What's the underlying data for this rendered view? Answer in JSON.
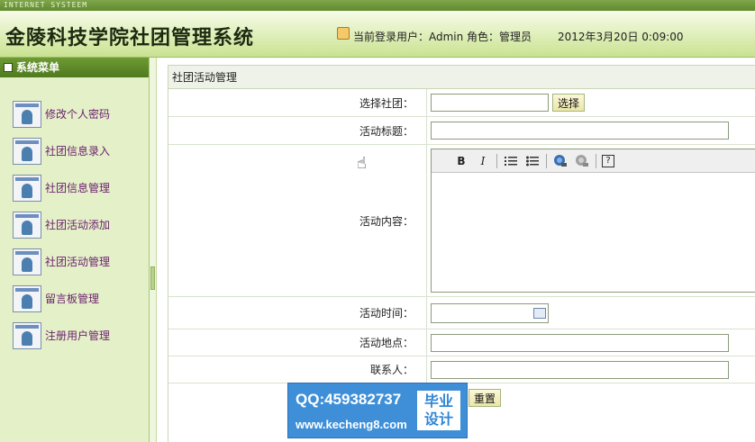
{
  "header": {
    "strip_text": "INTERNET SYSTEEM",
    "app_title": "金陵科技学院社团管理系统",
    "user_info": "当前登录用户：Admin 角色：管理员",
    "datetime": "2012年3月20日  0:09:00"
  },
  "sidebar": {
    "title": "系统菜单",
    "items": [
      {
        "label": "修改个人密码"
      },
      {
        "label": "社团信息录入"
      },
      {
        "label": "社团信息管理"
      },
      {
        "label": "社团活动添加"
      },
      {
        "label": "社团活动管理"
      },
      {
        "label": "留言板管理"
      },
      {
        "label": "注册用户管理"
      }
    ]
  },
  "panel": {
    "title": "社团活动管理"
  },
  "form": {
    "club_label": "选择社团：",
    "club_value": "",
    "select_button": "选择",
    "title_label": "活动标题：",
    "title_value": "",
    "content_label": "活动内容：",
    "editor_toolbar": {
      "bold": "B",
      "italic": "I",
      "help": "?"
    },
    "time_label": "活动时间：",
    "time_value": "",
    "place_label": "活动地点：",
    "place_value": "",
    "contact_label": "联系人：",
    "contact_value": "",
    "reset_button": "重置"
  },
  "watermark": {
    "qq": "QQ:459382737",
    "url": "www.kecheng8.com",
    "badge_line1": "毕业",
    "badge_line2": "设计"
  },
  "colors": {
    "sidebar_bg": "#e4f0c8",
    "header_bar": "#5f8a2d",
    "menu_text": "#6b1f6e",
    "watermark_bg": "#3f8fd8"
  }
}
